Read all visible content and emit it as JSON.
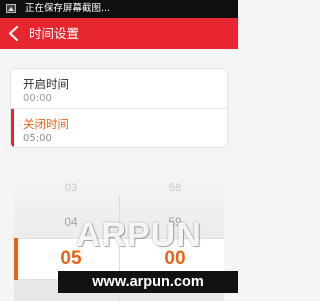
{
  "status_bar": {
    "notification_icon": "image-icon",
    "text": "正在保存屏幕截图..."
  },
  "header": {
    "back_icon": "chevron-left-icon",
    "title": "时间设置",
    "color": "#e8262f"
  },
  "settings": [
    {
      "label": "开启时间",
      "value": "00:00",
      "selected": false
    },
    {
      "label": "关闭时间",
      "value": "05:00",
      "selected": true
    }
  ],
  "picker": {
    "hours": [
      "03",
      "04",
      "05"
    ],
    "minutes": [
      "58",
      "59",
      "00"
    ],
    "selected_hour": "05",
    "selected_minute": "00",
    "accent_color": "#e8641b"
  },
  "watermark": {
    "logo": "ARPUN",
    "url": "www.arpun.com"
  }
}
